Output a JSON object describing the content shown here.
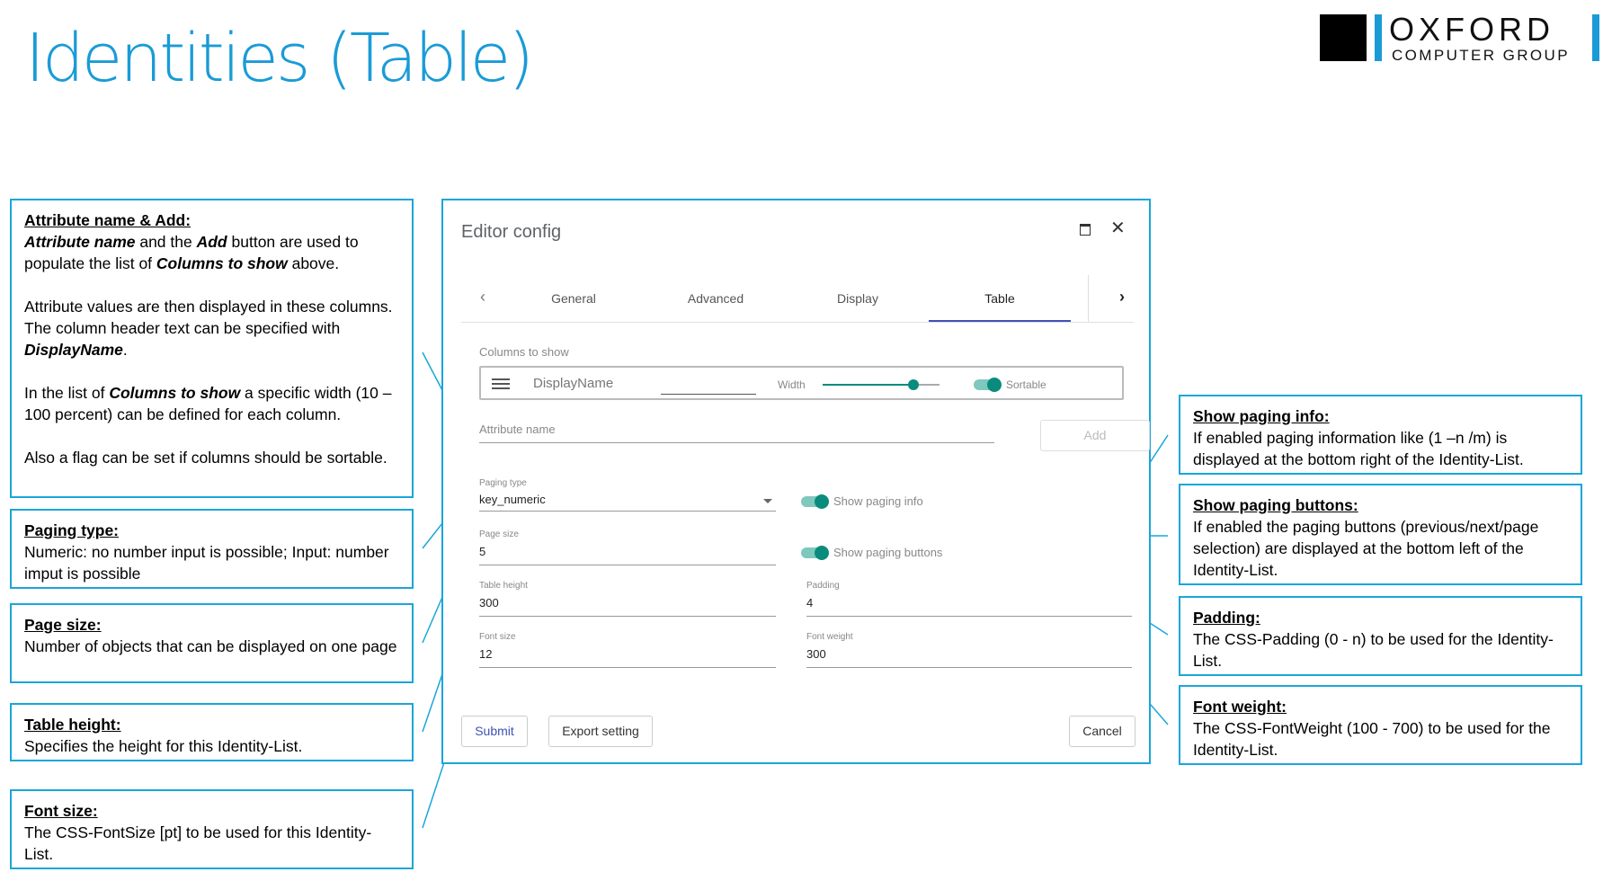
{
  "slide": {
    "title": "Identities (Table)",
    "logo": {
      "line1": "OXFORD",
      "line2": "COMPUTER GROUP"
    }
  },
  "notes": {
    "attribute": {
      "heading": "Attribute name & Add:",
      "p1": [
        {
          "t": "Attribute name",
          "em": true
        },
        {
          "t": " and the "
        },
        {
          "t": "Add",
          "em": true
        },
        {
          "t": " button are used to populate the list of "
        },
        {
          "t": "Columns to show",
          "em": true
        },
        {
          "t": " above."
        }
      ],
      "p2": [
        {
          "t": "Attribute values are then displayed in these columns. The column header text can be specified with "
        },
        {
          "t": "DisplayName",
          "em": true
        },
        {
          "t": "."
        }
      ],
      "p3": [
        {
          "t": "In the list of "
        },
        {
          "t": "Columns to show",
          "em": true
        },
        {
          "t": " a specific width (10 – 100 percent) can be defined for each column."
        }
      ],
      "p4": [
        {
          "t": "Also a flag can be set if columns should be sortable."
        }
      ]
    },
    "paging_type": {
      "heading": "Paging type:",
      "text": "Numeric: no number input is possible; Input: number imput is possible"
    },
    "page_size": {
      "heading": "Page size:",
      "text": "Number of objects that can be displayed on one page"
    },
    "table_height": {
      "heading": "Table height:",
      "text": "Specifies the height for this Identity-List."
    },
    "font_size": {
      "heading": "Font size:",
      "text": "The CSS-FontSize [pt] to be used for this Identity-List."
    },
    "show_paging_info": {
      "heading": "Show paging info:",
      "text": "If enabled paging information like (1 –n /m) is displayed at the bottom right of the Identity-List."
    },
    "show_paging_buttons": {
      "heading": "Show paging buttons:",
      "text": "If enabled the paging buttons (previous/next/page selection) are displayed at the bottom left of the Identity-List."
    },
    "padding": {
      "heading": "Padding:",
      "text": "The CSS-Padding (0 - n) to be used for the Identity-List."
    },
    "font_weight": {
      "heading": "Font weight:",
      "text": "The CSS-FontWeight (100 - 700) to be used for the Identity-List."
    }
  },
  "dialog": {
    "title": "Editor config",
    "tabs": [
      "General",
      "Advanced",
      "Display",
      "Table"
    ],
    "active_tab": "Table",
    "columns_to_show_label": "Columns to show",
    "column_row": {
      "name": "DisplayName",
      "width_label": "Width",
      "width_percent": 80,
      "sortable_label": "Sortable",
      "sortable": true
    },
    "attribute_name_placeholder": "Attribute name",
    "add_label": "Add",
    "paging_type": {
      "label": "Paging type",
      "value": "key_numeric"
    },
    "show_paging_info": {
      "label": "Show paging info",
      "enabled": true
    },
    "page_size": {
      "label": "Page size",
      "value": "5"
    },
    "show_paging_buttons": {
      "label": "Show paging buttons",
      "enabled": true
    },
    "table_height": {
      "label": "Table height",
      "value": "300"
    },
    "padding": {
      "label": "Padding",
      "value": "4"
    },
    "font_size": {
      "label": "Font size",
      "value": "12"
    },
    "font_weight": {
      "label": "Font weight",
      "value": "300"
    },
    "buttons": {
      "submit": "Submit",
      "export": "Export setting",
      "cancel": "Cancel"
    }
  },
  "colors": {
    "title": "#1a9bd7",
    "accent_border": "#1aa6d9",
    "toggle": "#0a8c7c",
    "tab_indicator": "#3f51b5"
  }
}
